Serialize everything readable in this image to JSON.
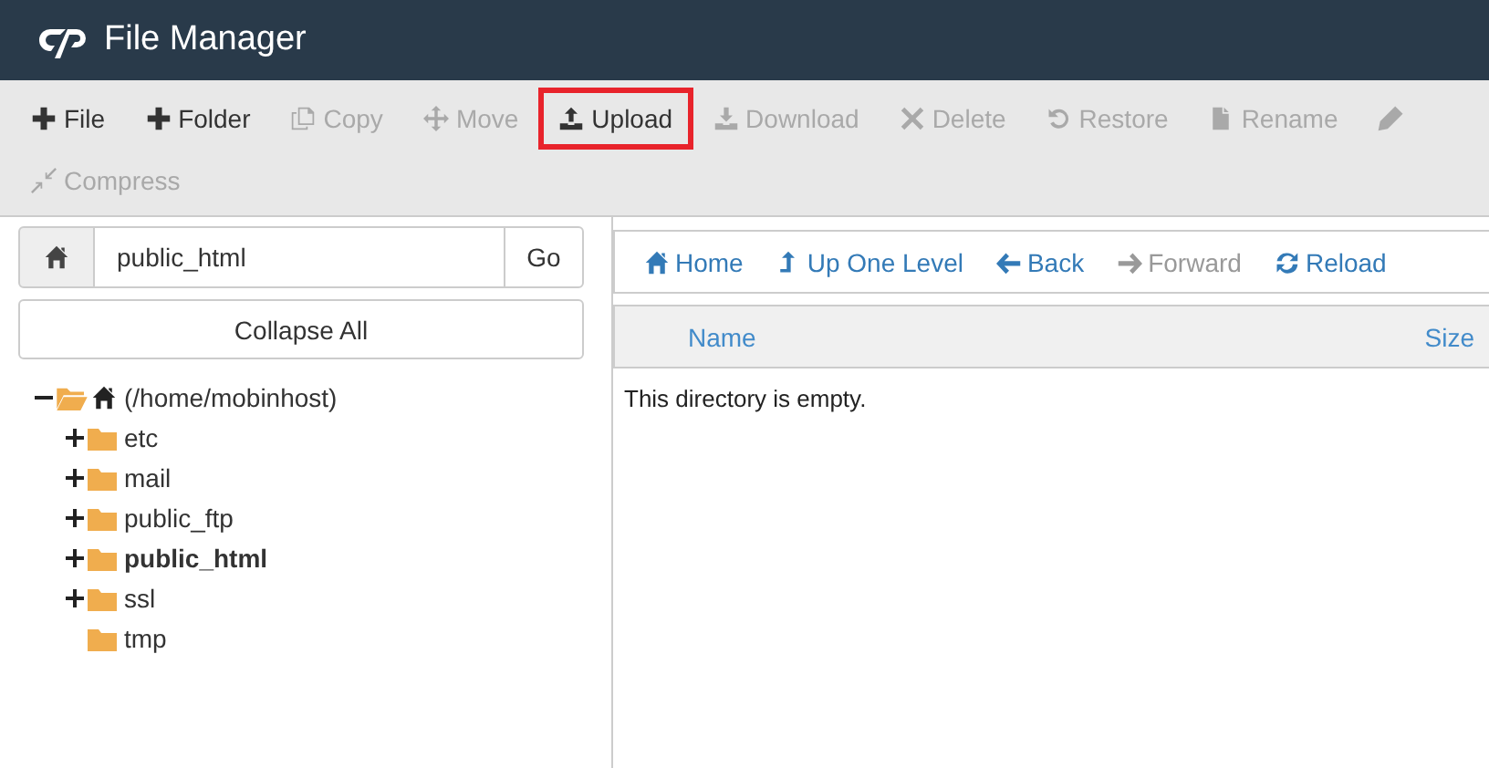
{
  "header": {
    "title": "File Manager"
  },
  "toolbar": [
    {
      "label": "File",
      "kind": "plus",
      "disabled": false,
      "highlighted": false
    },
    {
      "label": "Folder",
      "kind": "plus",
      "disabled": false,
      "highlighted": false
    },
    {
      "label": "Copy",
      "kind": "copy",
      "disabled": true,
      "highlighted": false
    },
    {
      "label": "Move",
      "kind": "move",
      "disabled": true,
      "highlighted": false
    },
    {
      "label": "Upload",
      "kind": "upload",
      "disabled": false,
      "highlighted": true
    },
    {
      "label": "Download",
      "kind": "download",
      "disabled": true,
      "highlighted": false
    },
    {
      "label": "Delete",
      "kind": "delete",
      "disabled": true,
      "highlighted": false
    },
    {
      "label": "Restore",
      "kind": "restore",
      "disabled": true,
      "highlighted": false
    },
    {
      "label": "Rename",
      "kind": "file",
      "disabled": true,
      "highlighted": false
    },
    {
      "kind": "pencil",
      "disabled": true,
      "highlighted": false
    },
    {
      "label": "Compress",
      "kind": "compress",
      "disabled": true,
      "highlighted": false
    }
  ],
  "path_bar": {
    "value": "public_html",
    "go": "Go"
  },
  "collapse_button": "Collapse All",
  "tree": {
    "label": "(/home/mobinhost)",
    "expanded": true,
    "selected": false,
    "children": [
      {
        "label": "etc",
        "expandable": true,
        "selected": false
      },
      {
        "label": "mail",
        "expandable": true,
        "selected": false
      },
      {
        "label": "public_ftp",
        "expandable": true,
        "selected": false
      },
      {
        "label": "public_html",
        "expandable": true,
        "selected": true
      },
      {
        "label": "ssl",
        "expandable": true,
        "selected": false
      },
      {
        "label": "tmp",
        "expandable": false,
        "selected": false
      }
    ]
  },
  "nav": [
    {
      "label": "Home",
      "kind": "home",
      "disabled": false
    },
    {
      "label": "Up One Level",
      "kind": "up",
      "disabled": false
    },
    {
      "label": "Back",
      "kind": "back",
      "disabled": false
    },
    {
      "label": "Forward",
      "kind": "forward",
      "disabled": true
    },
    {
      "label": "Reload",
      "kind": "reload",
      "disabled": false
    }
  ],
  "table": {
    "columns": [
      "Name",
      "Size"
    ],
    "empty_message": "This directory is empty."
  }
}
